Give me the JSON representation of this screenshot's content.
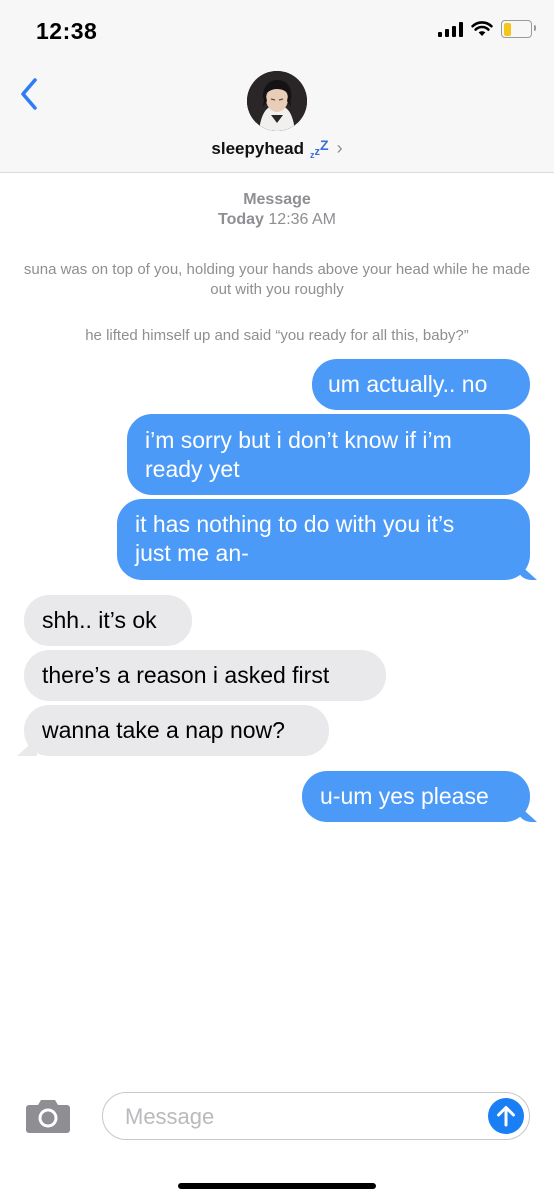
{
  "status_bar": {
    "time": "12:38",
    "battery_level": 0.3,
    "battery_color": "#f5c518"
  },
  "header": {
    "back_icon": "chevron-left-icon",
    "contact_name": "sleepyhead",
    "contact_emoji": "zzz",
    "details_icon": "chevron-right-icon"
  },
  "conversation": {
    "service_label": "Message",
    "date_day": "Today",
    "date_time": "12:36 AM",
    "narration": [
      "suna was on top of you, holding your hands above your head while he made out with you roughly",
      "he lifted himself up and said “you ready for all this, baby?”"
    ],
    "messages": [
      {
        "from": "me",
        "lines": [
          "um actually.. no"
        ]
      },
      {
        "from": "me",
        "lines": [
          "i’m sorry but i don’t know if i’m",
          "ready yet"
        ]
      },
      {
        "from": "me",
        "lines": [
          "it has nothing to do with you it’s",
          "just me an-"
        ]
      },
      {
        "from": "them",
        "lines": [
          "shh.. it’s ok"
        ]
      },
      {
        "from": "them",
        "lines": [
          "there’s a reason i asked first"
        ]
      },
      {
        "from": "them",
        "lines": [
          "wanna take a nap now?"
        ]
      },
      {
        "from": "me",
        "lines": [
          "u-um yes please"
        ]
      }
    ]
  },
  "composer": {
    "camera_icon": "camera-icon",
    "placeholder": "Message",
    "value": "",
    "send_icon": "arrow-up-icon"
  },
  "colors": {
    "sent_bubble": "#4b9af7",
    "received_bubble": "#e9e9ec",
    "accent": "#1a7ef5"
  }
}
